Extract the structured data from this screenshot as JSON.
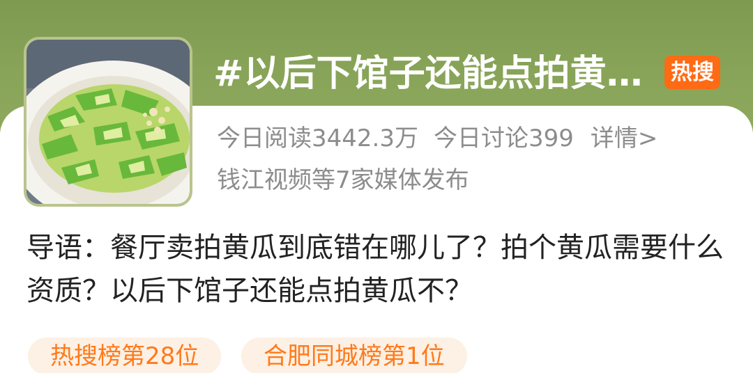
{
  "topic": {
    "title": "#以后下馆子还能点拍黄…",
    "badge": "热搜",
    "thumbnail_icon": "smashed-cucumber-dish-photo"
  },
  "stats": {
    "reads": "今日阅读3442.3万",
    "discussions": "今日讨论399",
    "detail_link": "详情>"
  },
  "media": {
    "text": "钱江视频等7家媒体发布"
  },
  "intro": {
    "text": "导语：餐厅卖拍黄瓜到底错在哪儿了？拍个黄瓜需要什么资质？以后下馆子还能点拍黄瓜不？"
  },
  "rank_tags": [
    {
      "label": "热搜榜第28位"
    },
    {
      "label": "合肥同城榜第1位"
    }
  ],
  "colors": {
    "header_green": "#88a458",
    "hot_orange": "#ff6a14",
    "tag_bg": "#fdf0e4",
    "tag_text": "#ff7a1a",
    "muted_text": "#8c8c8c"
  }
}
